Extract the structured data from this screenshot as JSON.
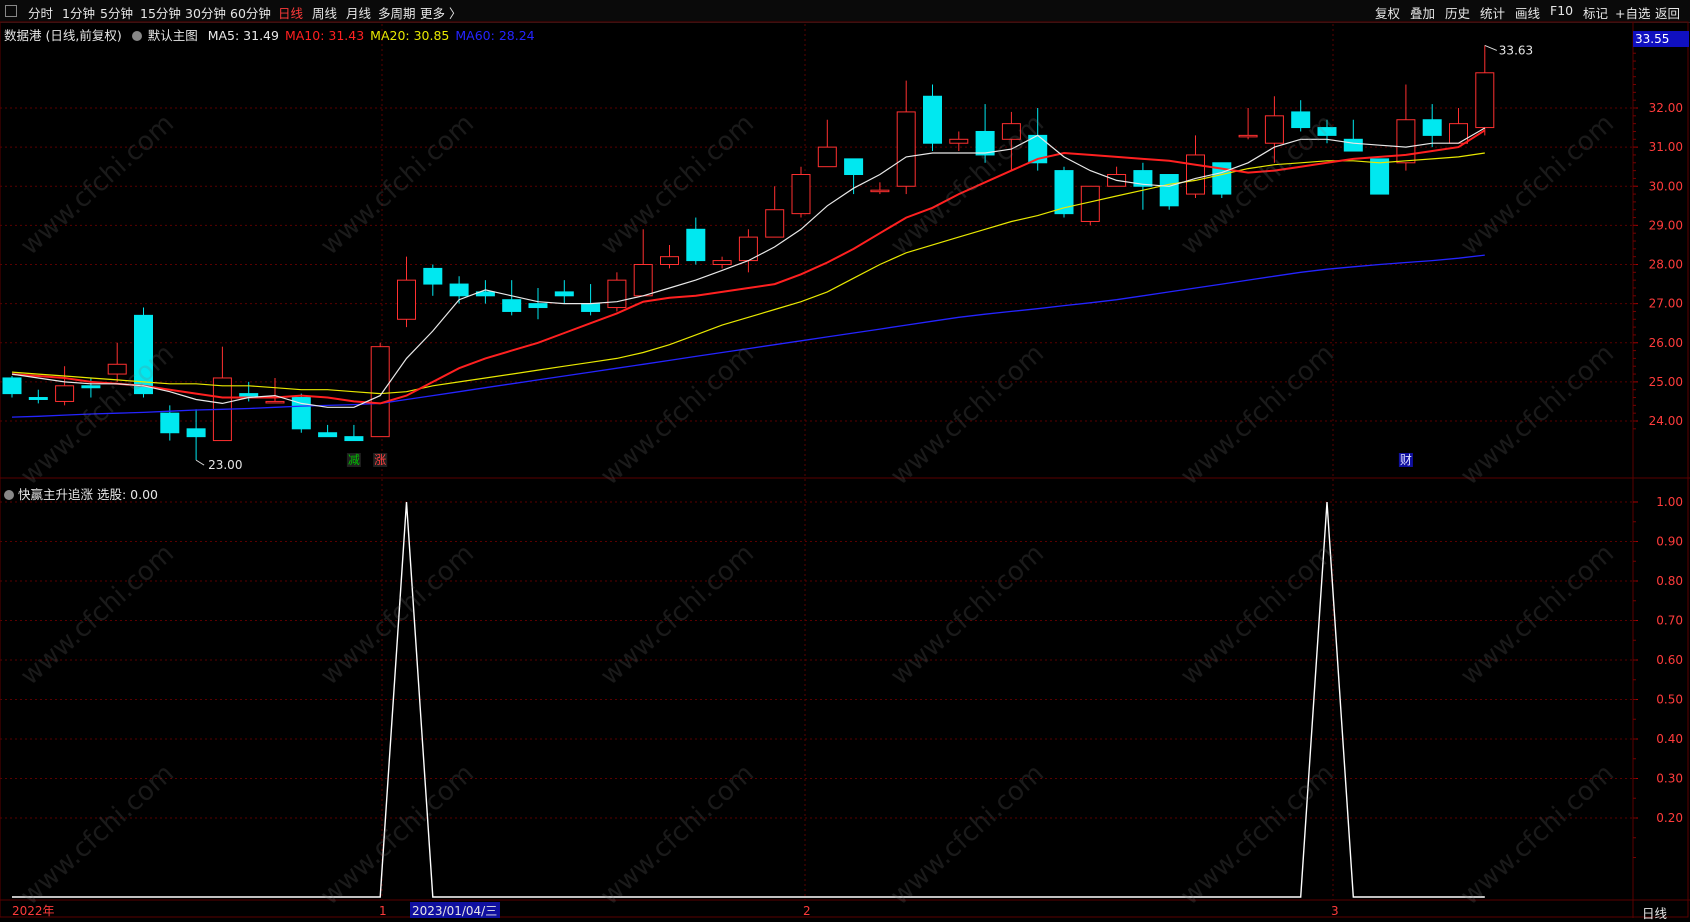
{
  "toolbar": {
    "left_items": [
      "分时",
      "1分钟",
      "5分钟",
      "15分钟",
      "30分钟",
      "60分钟",
      "日线",
      "周线",
      "月线",
      "多周期",
      "更多 〉"
    ],
    "active": "日线",
    "right_items": [
      "复权",
      "叠加",
      "历史",
      "统计",
      "画线",
      "F10",
      "标记",
      "+自选",
      "返回"
    ]
  },
  "upper": {
    "stock_name": "数据港 (日线,前复权)",
    "main_chart_label": "默认主图",
    "ma_labels": [
      {
        "text": "MA5: 31.49",
        "color": "#e8e8e8"
      },
      {
        "text": "MA10: 31.43",
        "color": "#ff2020"
      },
      {
        "text": "MA20: 30.85",
        "color": "#e8e800"
      },
      {
        "text": "MA60: 28.24",
        "color": "#2424ff"
      }
    ],
    "price_box": "33.55",
    "axis_ticks": [
      "32.00",
      "31.00",
      "30.00",
      "29.00",
      "28.00",
      "27.00",
      "26.00",
      "25.00",
      "24.00"
    ],
    "high_label": "33.63",
    "low_label": "23.00",
    "markers": [
      {
        "text": "减",
        "color": "#00c000"
      },
      {
        "text": "涨",
        "color": "#ff4040"
      },
      {
        "text": "财",
        "color": "#e0e0ff"
      }
    ]
  },
  "lower": {
    "indicator_label": "快赢主升追涨  选股: 0.00",
    "axis_ticks": [
      "1.00",
      "0.90",
      "0.80",
      "0.70",
      "0.60",
      "0.50",
      "0.40",
      "0.30",
      "0.20"
    ]
  },
  "bottom": {
    "date_labels": [
      "2022年",
      "1",
      "2023/01/04/三",
      "2",
      "3"
    ],
    "right_label": "日线"
  },
  "watermark": "www.cfchi.com",
  "colors": {
    "up": "#ff3030",
    "down": "#00e8f0",
    "ma5": "#e8e8e8",
    "ma10": "#ff2020",
    "ma20": "#e8e800",
    "ma60": "#2424ff",
    "grid": "#5a0000",
    "indicator": "#ffffff"
  },
  "chart_data": {
    "type": "candlestick",
    "candles": [
      [
        25.1,
        24.7,
        25.15,
        24.6
      ],
      [
        24.6,
        24.55,
        24.8,
        24.45
      ],
      [
        24.5,
        24.9,
        25.4,
        24.4
      ],
      [
        24.9,
        24.85,
        25.1,
        24.6
      ],
      [
        25.2,
        25.45,
        26.0,
        25.0
      ],
      [
        26.7,
        24.7,
        26.9,
        24.6
      ],
      [
        24.2,
        23.7,
        24.4,
        23.5
      ],
      [
        23.8,
        23.6,
        24.3,
        23.0
      ],
      [
        23.5,
        25.1,
        25.9,
        23.5
      ],
      [
        24.7,
        24.6,
        25.0,
        24.5
      ],
      [
        24.5,
        24.5,
        25.1,
        24.5
      ],
      [
        24.6,
        23.8,
        24.7,
        23.7
      ],
      [
        23.7,
        23.6,
        23.9,
        23.6
      ],
      [
        23.6,
        23.5,
        23.9,
        23.5
      ],
      [
        23.6,
        25.9,
        26.0,
        23.6
      ],
      [
        26.6,
        27.6,
        28.2,
        26.4
      ],
      [
        27.9,
        27.5,
        28.0,
        27.2
      ],
      [
        27.5,
        27.2,
        27.7,
        27.0
      ],
      [
        27.3,
        27.2,
        27.6,
        27.0
      ],
      [
        27.1,
        26.8,
        27.6,
        26.7
      ],
      [
        27.0,
        26.9,
        27.4,
        26.6
      ],
      [
        27.3,
        27.2,
        27.6,
        27.0
      ],
      [
        27.0,
        26.8,
        27.5,
        26.7
      ],
      [
        26.9,
        27.6,
        27.8,
        26.8
      ],
      [
        27.2,
        28.0,
        28.9,
        27.2
      ],
      [
        28.0,
        28.2,
        28.5,
        27.9
      ],
      [
        28.9,
        28.1,
        29.2,
        28.0
      ],
      [
        28.0,
        28.1,
        28.2,
        27.9
      ],
      [
        28.1,
        28.7,
        28.9,
        27.8
      ],
      [
        28.7,
        29.4,
        30.0,
        28.7
      ],
      [
        29.3,
        30.3,
        30.5,
        29.2
      ],
      [
        30.5,
        31.0,
        31.7,
        30.5
      ],
      [
        30.7,
        30.3,
        30.7,
        29.8
      ],
      [
        29.9,
        29.9,
        30.1,
        29.8
      ],
      [
        30.0,
        31.9,
        32.7,
        29.8
      ],
      [
        32.3,
        31.1,
        32.6,
        30.9
      ],
      [
        31.1,
        31.2,
        31.4,
        30.9
      ],
      [
        31.4,
        30.8,
        32.1,
        30.6
      ],
      [
        31.2,
        31.6,
        31.9,
        30.4
      ],
      [
        31.3,
        30.6,
        32.0,
        30.4
      ],
      [
        30.4,
        29.3,
        30.5,
        29.2
      ],
      [
        29.1,
        30.0,
        30.0,
        29.0
      ],
      [
        30.0,
        30.3,
        30.5,
        30.0
      ],
      [
        30.4,
        30.0,
        30.6,
        29.4
      ],
      [
        30.3,
        29.5,
        30.3,
        29.4
      ],
      [
        29.8,
        30.8,
        31.3,
        29.7
      ],
      [
        30.6,
        29.8,
        30.6,
        29.7
      ],
      [
        31.3,
        31.3,
        32.0,
        31.2
      ],
      [
        31.1,
        31.8,
        32.3,
        30.6
      ],
      [
        31.9,
        31.5,
        32.2,
        31.4
      ],
      [
        31.5,
        31.3,
        31.7,
        31.1
      ],
      [
        31.2,
        30.9,
        31.7,
        30.9
      ],
      [
        30.7,
        29.8,
        30.7,
        29.8
      ],
      [
        30.6,
        31.7,
        32.6,
        30.4
      ],
      [
        31.7,
        31.3,
        32.1,
        31.0
      ],
      [
        31.1,
        31.6,
        32.0,
        31.1
      ],
      [
        31.5,
        32.9,
        33.6,
        31.3
      ]
    ],
    "ma5": [
      25.2,
      25.1,
      25.0,
      24.95,
      24.95,
      24.9,
      24.75,
      24.55,
      24.45,
      24.6,
      24.65,
      24.45,
      24.35,
      24.35,
      24.65,
      25.6,
      26.3,
      27.1,
      27.35,
      27.2,
      27.05,
      27.0,
      27.0,
      27.05,
      27.2,
      27.4,
      27.6,
      27.85,
      28.1,
      28.45,
      28.9,
      29.5,
      29.95,
      30.3,
      30.75,
      30.85,
      30.85,
      30.85,
      30.95,
      31.3,
      30.75,
      30.4,
      30.15,
      30.05,
      30.0,
      30.2,
      30.35,
      30.6,
      31.0,
      31.2,
      31.2,
      31.1,
      31.05,
      31.0,
      31.1,
      31.1,
      31.49
    ],
    "ma10": [
      25.2,
      25.15,
      25.1,
      25.0,
      24.95,
      24.9,
      24.8,
      24.7,
      24.6,
      24.6,
      24.6,
      24.65,
      24.6,
      24.5,
      24.45,
      24.65,
      25.0,
      25.35,
      25.6,
      25.8,
      26.0,
      26.25,
      26.5,
      26.75,
      27.05,
      27.15,
      27.2,
      27.3,
      27.4,
      27.5,
      27.75,
      28.05,
      28.4,
      28.8,
      29.2,
      29.45,
      29.8,
      30.1,
      30.4,
      30.7,
      30.85,
      30.8,
      30.75,
      30.7,
      30.65,
      30.55,
      30.45,
      30.35,
      30.4,
      30.5,
      30.6,
      30.7,
      30.75,
      30.8,
      30.9,
      31.0,
      31.43
    ],
    "ma20": [
      25.25,
      25.2,
      25.15,
      25.1,
      25.05,
      25.0,
      24.95,
      24.95,
      24.9,
      24.9,
      24.85,
      24.8,
      24.8,
      24.75,
      24.7,
      24.75,
      24.9,
      25.0,
      25.1,
      25.2,
      25.3,
      25.4,
      25.5,
      25.6,
      25.75,
      25.95,
      26.2,
      26.45,
      26.65,
      26.85,
      27.05,
      27.3,
      27.65,
      28.0,
      28.3,
      28.5,
      28.7,
      28.9,
      29.1,
      29.25,
      29.45,
      29.6,
      29.75,
      29.9,
      30.05,
      30.15,
      30.3,
      30.45,
      30.55,
      30.6,
      30.65,
      30.65,
      30.6,
      30.65,
      30.7,
      30.75,
      30.85
    ],
    "ma60": [
      24.1,
      24.12,
      24.15,
      24.18,
      24.2,
      24.22,
      24.25,
      24.28,
      24.3,
      24.32,
      24.35,
      24.38,
      24.4,
      24.42,
      24.45,
      24.55,
      24.65,
      24.75,
      24.85,
      24.95,
      25.05,
      25.15,
      25.25,
      25.35,
      25.45,
      25.55,
      25.65,
      25.75,
      25.85,
      25.95,
      26.05,
      26.15,
      26.25,
      26.35,
      26.45,
      26.55,
      26.65,
      26.73,
      26.8,
      26.87,
      26.95,
      27.02,
      27.1,
      27.2,
      27.3,
      27.4,
      27.5,
      27.6,
      27.7,
      27.8,
      27.88,
      27.94,
      28.0,
      28.05,
      28.1,
      28.16,
      28.24
    ],
    "indicator": [
      0,
      0,
      0,
      0,
      0,
      0,
      0,
      0,
      0,
      0,
      0,
      0,
      0,
      0,
      0,
      1,
      0,
      0,
      0,
      0,
      0,
      0,
      0,
      0,
      0,
      0,
      0,
      0,
      0,
      0,
      0,
      0,
      0,
      0,
      0,
      0,
      0,
      0,
      0,
      0,
      0,
      0,
      0,
      0,
      0,
      0,
      0,
      0,
      0,
      0,
      1,
      0,
      0,
      0,
      0,
      0,
      0
    ],
    "upper_ylim": [
      23.6,
      33.9
    ],
    "lower_ylim": [
      0,
      1.0
    ]
  }
}
